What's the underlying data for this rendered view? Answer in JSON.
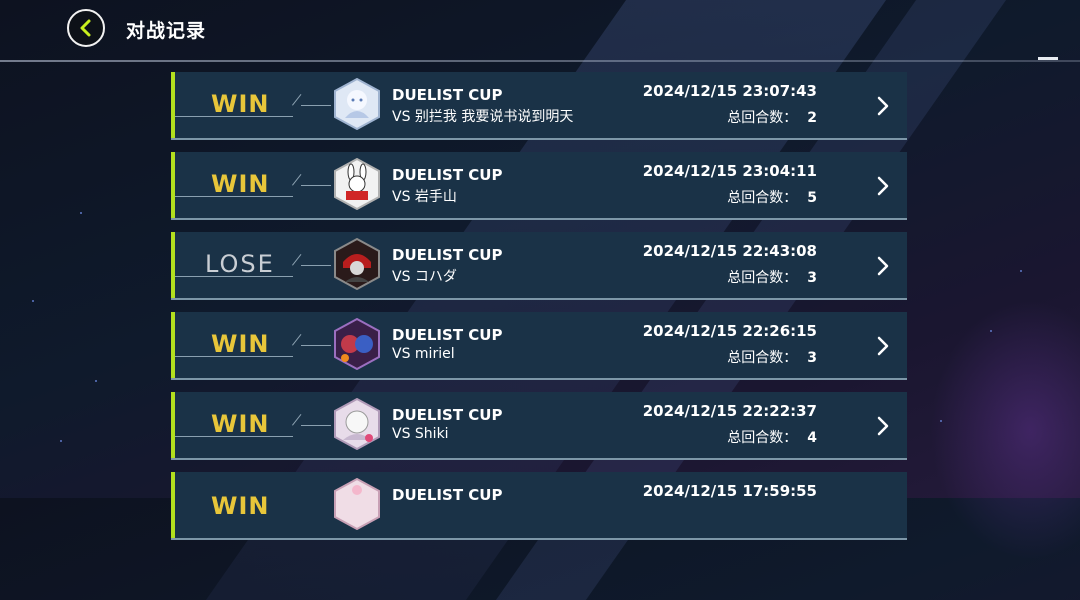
{
  "header": {
    "title": "对战记录"
  },
  "records": [
    {
      "result": "WIN",
      "event": "DUELIST CUP",
      "opponent": "VS 别拦我 我要说书说到明天",
      "datetime": "2024/12/15 23:07:43",
      "turns_label": "总回合数：",
      "turns": "2",
      "avatar_icon": "ice-avatar-icon"
    },
    {
      "result": "WIN",
      "event": "DUELIST CUP",
      "opponent": "VS 岩手山",
      "datetime": "2024/12/15 23:04:11",
      "turns_label": "总回合数：",
      "turns": "5",
      "avatar_icon": "rabbit-avatar-icon"
    },
    {
      "result": "LOSE",
      "event": "DUELIST CUP",
      "opponent": "VS コハダ",
      "datetime": "2024/12/15 22:43:08",
      "turns_label": "总回合数：",
      "turns": "3",
      "avatar_icon": "masked-avatar-icon"
    },
    {
      "result": "WIN",
      "event": "DUELIST CUP",
      "opponent": "VS miriel",
      "datetime": "2024/12/15 22:26:15",
      "turns_label": "总回合数：",
      "turns": "3",
      "avatar_icon": "duo-avatar-icon"
    },
    {
      "result": "WIN",
      "event": "DUELIST CUP",
      "opponent": "VS Shiki",
      "datetime": "2024/12/15 22:22:37",
      "turns_label": "总回合数：",
      "turns": "4",
      "avatar_icon": "white-hair-avatar-icon"
    },
    {
      "result": "WIN",
      "event": "DUELIST CUP",
      "opponent": "",
      "datetime": "2024/12/15 17:59:55",
      "turns_label": "",
      "turns": "",
      "avatar_icon": "flower-avatar-icon"
    }
  ],
  "colors": {
    "win": "#e8c63a",
    "lose": "#c9ced4",
    "accent": "#b3e01e",
    "row_bg": "#1a3247"
  }
}
